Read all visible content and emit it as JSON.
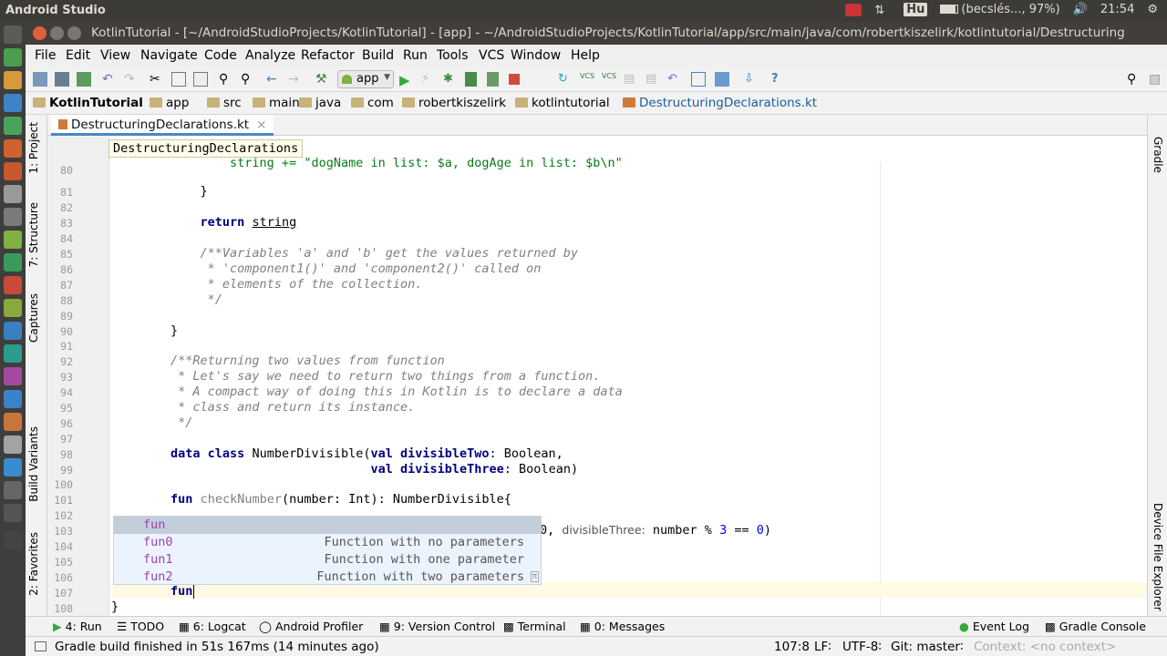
{
  "system": {
    "app_name": "Android Studio",
    "keyboard": "Hu",
    "battery": "(becslés..., 97%)",
    "clock": "21:54"
  },
  "window": {
    "title": "KotlinTutorial - [~/AndroidStudioProjects/KotlinTutorial] - [app] - ~/AndroidStudioProjects/KotlinTutorial/app/src/main/java/com/robertkiszelirk/kotlintutorial/Destructuring"
  },
  "menu": [
    "File",
    "Edit",
    "View",
    "Navigate",
    "Code",
    "Analyze",
    "Refactor",
    "Build",
    "Run",
    "Tools",
    "VCS",
    "Window",
    "Help"
  ],
  "toolbar": {
    "config": "app"
  },
  "breadcrumb": [
    "KotlinTutorial",
    "app",
    "src",
    "main",
    "java",
    "com",
    "robertkiszelirk",
    "kotlintutorial",
    "DestructuringDeclarations.kt"
  ],
  "left_tools": [
    "1: Project",
    "7: Structure",
    "Captures",
    "Build Variants",
    "2: Favorites"
  ],
  "right_tools": [
    "Gradle",
    "Device File Explorer"
  ],
  "editor": {
    "tab": "DestructuringDeclarations.kt",
    "sticky": "DestructuringDeclarations",
    "lines": [
      {
        "n": "80",
        "t": "                string += \"dogName in list: $a, dogAge in list: $b\\n\""
      },
      {
        "n": "81",
        "t": "            }"
      },
      {
        "n": "82",
        "t": ""
      },
      {
        "n": "83",
        "t": "            return string"
      },
      {
        "n": "84",
        "t": ""
      },
      {
        "n": "85",
        "t": "            /**Variables 'a' and 'b' get the values returned by"
      },
      {
        "n": "86",
        "t": "             * 'component1()' and 'component2()' called on"
      },
      {
        "n": "87",
        "t": "             * elements of the collection."
      },
      {
        "n": "88",
        "t": "             */"
      },
      {
        "n": "89",
        "t": ""
      },
      {
        "n": "90",
        "t": "        }"
      },
      {
        "n": "91",
        "t": ""
      },
      {
        "n": "92",
        "t": "        /**Returning two values from function"
      },
      {
        "n": "93",
        "t": "         * Let's say we need to return two things from a function."
      },
      {
        "n": "94",
        "t": "         * A compact way of doing this in Kotlin is to declare a data"
      },
      {
        "n": "95",
        "t": "         * class and return its instance."
      },
      {
        "n": "96",
        "t": "         */"
      },
      {
        "n": "97",
        "t": ""
      },
      {
        "n": "98",
        "t": "        data class NumberDivisible(val divisibleTwo: Boolean,"
      },
      {
        "n": "99",
        "t": "                                   val divisibleThree: Boolean)"
      },
      {
        "n": "100",
        "t": ""
      },
      {
        "n": "101",
        "t": "        fun checkNumber(number: Int): NumberDivisible{"
      },
      {
        "n": "102",
        "t": ""
      },
      {
        "n": "103",
        "t": "0, divisibleThree: number % 3 == 0)"
      },
      {
        "n": "104",
        "t": ""
      },
      {
        "n": "105",
        "t": ""
      },
      {
        "n": "106",
        "t": ""
      },
      {
        "n": "107",
        "t": "        fun"
      },
      {
        "n": "108",
        "t": "}"
      }
    ]
  },
  "completion": [
    {
      "name": "fun",
      "desc": ""
    },
    {
      "name": "fun0",
      "desc": "Function with no parameters"
    },
    {
      "name": "fun1",
      "desc": "Function with one parameter"
    },
    {
      "name": "fun2",
      "desc": "Function with two parameters"
    }
  ],
  "bottom_tools": {
    "run": "4: Run",
    "todo": "TODO",
    "logcat": "6: Logcat",
    "profiler": "Android Profiler",
    "vcs": "9: Version Control",
    "terminal": "Terminal",
    "messages": "0: Messages",
    "event_log": "Event Log",
    "gradle_console": "Gradle Console"
  },
  "status": {
    "message": "Gradle build finished in 51s 167ms (14 minutes ago)",
    "position": "107:8",
    "line_sep": "LF∶",
    "encoding": "UTF-8∶",
    "git": "Git: master∶",
    "context": "Context: <no context>"
  }
}
